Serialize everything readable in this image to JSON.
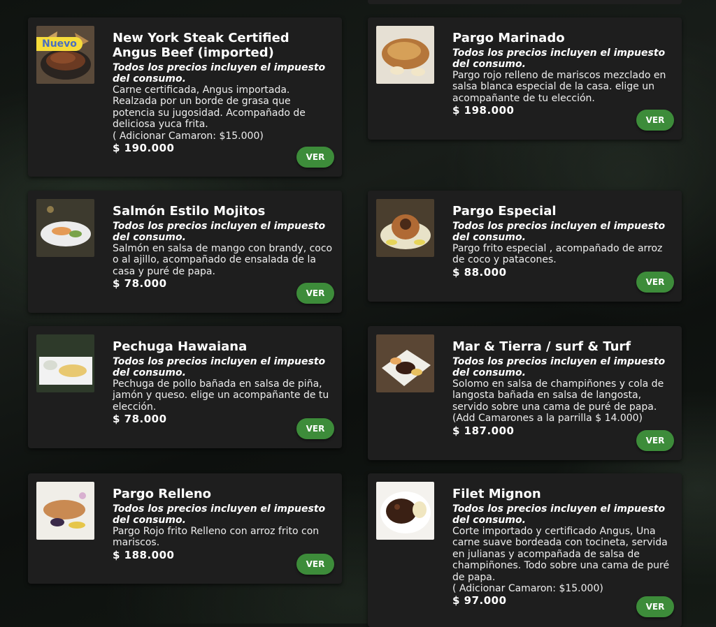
{
  "common": {
    "tax_note": "Todos los precios incluyen el impuesto del consumo.",
    "view_label": "VER",
    "new_badge": "Nuevo",
    "accent_color": "#3d8c3a",
    "badge_color": "#f6dc3b"
  },
  "items": [
    {
      "title": "New York Steak Certified Angus Beef (imported)",
      "description": "Carne certificada, Angus importada. Realzada por un borde de grasa que potencia su jugosidad. Acompañado de deliciosa yuca frita.\n( Adicionar Camaron: $15.000)",
      "price": "$ 190.000",
      "badge": "Nuevo",
      "image_icon": "steak-dish-icon"
    },
    {
      "title": "Pargo Marinado",
      "description": "Pargo rojo relleno de mariscos mezclado en salsa blanca especial de la casa. elige un acompañante de tu elección.",
      "price": "$ 198.000",
      "image_icon": "fried-fish-icon"
    },
    {
      "title": "Salmón Estilo Mojitos",
      "description": "Salmón en salsa de mango con brandy, coco o al ajillo, acompañado de ensalada de la casa y puré de papa.",
      "price": "$ 78.000",
      "image_icon": "salmon-plate-icon"
    },
    {
      "title": "Pargo Especial",
      "description": "Pargo frito especial , acompañado de arroz de coco y patacones.",
      "price": "$ 88.000",
      "image_icon": "fish-platter-icon"
    },
    {
      "title": "Pechuga Hawaiana",
      "description": "Pechuga de pollo bañada en salsa de piña, jamón y queso. elige un acompañante de tu elección.",
      "price": "$ 78.000",
      "image_icon": "chicken-plate-icon"
    },
    {
      "title": "Mar & Tierra / surf & Turf",
      "description": "Solomo en salsa de champiñones y cola de langosta bañada en salsa de langosta, servido sobre una cama de puré de papa.\n(Add Camarones a la parrilla $ 14.000)",
      "price": "$ 187.000",
      "image_icon": "surf-turf-icon"
    },
    {
      "title": "Pargo Relleno",
      "description": "Pargo Rojo frito Relleno con arroz frito con mariscos.",
      "price": "$ 188.000",
      "image_icon": "stuffed-fish-icon"
    },
    {
      "title": "Filet Mignon",
      "description": "Corte importado y certificado Angus, Una carne suave bordeada con tocineta, servida en julianas y acompañada de salsa de champiñones. Todo sobre una cama de puré de papa.\n( Adicionar Camaron: $15.000)",
      "price": "$ 97.000",
      "image_icon": "filet-mignon-icon"
    }
  ]
}
